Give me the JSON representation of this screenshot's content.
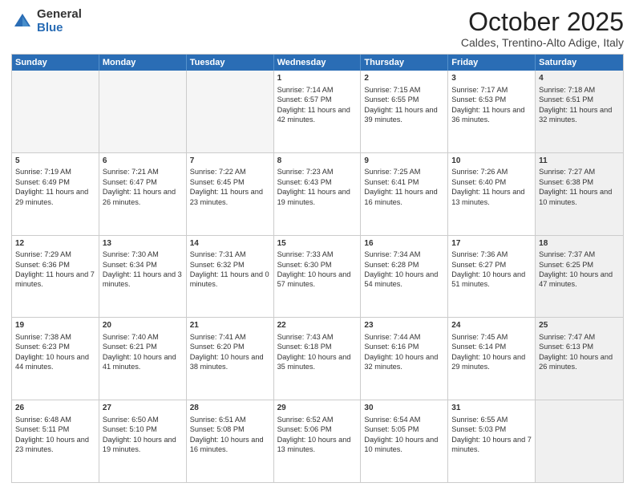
{
  "logo": {
    "general": "General",
    "blue": "Blue"
  },
  "title": {
    "month": "October 2025",
    "location": "Caldes, Trentino-Alto Adige, Italy"
  },
  "calendar": {
    "headers": [
      "Sunday",
      "Monday",
      "Tuesday",
      "Wednesday",
      "Thursday",
      "Friday",
      "Saturday"
    ],
    "rows": [
      [
        {
          "day": "",
          "info": "",
          "empty": true
        },
        {
          "day": "",
          "info": "",
          "empty": true
        },
        {
          "day": "",
          "info": "",
          "empty": true
        },
        {
          "day": "1",
          "info": "Sunrise: 7:14 AM\nSunset: 6:57 PM\nDaylight: 11 hours and 42 minutes."
        },
        {
          "day": "2",
          "info": "Sunrise: 7:15 AM\nSunset: 6:55 PM\nDaylight: 11 hours and 39 minutes."
        },
        {
          "day": "3",
          "info": "Sunrise: 7:17 AM\nSunset: 6:53 PM\nDaylight: 11 hours and 36 minutes."
        },
        {
          "day": "4",
          "info": "Sunrise: 7:18 AM\nSunset: 6:51 PM\nDaylight: 11 hours and 32 minutes.",
          "shaded": true
        }
      ],
      [
        {
          "day": "5",
          "info": "Sunrise: 7:19 AM\nSunset: 6:49 PM\nDaylight: 11 hours and 29 minutes."
        },
        {
          "day": "6",
          "info": "Sunrise: 7:21 AM\nSunset: 6:47 PM\nDaylight: 11 hours and 26 minutes."
        },
        {
          "day": "7",
          "info": "Sunrise: 7:22 AM\nSunset: 6:45 PM\nDaylight: 11 hours and 23 minutes."
        },
        {
          "day": "8",
          "info": "Sunrise: 7:23 AM\nSunset: 6:43 PM\nDaylight: 11 hours and 19 minutes."
        },
        {
          "day": "9",
          "info": "Sunrise: 7:25 AM\nSunset: 6:41 PM\nDaylight: 11 hours and 16 minutes."
        },
        {
          "day": "10",
          "info": "Sunrise: 7:26 AM\nSunset: 6:40 PM\nDaylight: 11 hours and 13 minutes."
        },
        {
          "day": "11",
          "info": "Sunrise: 7:27 AM\nSunset: 6:38 PM\nDaylight: 11 hours and 10 minutes.",
          "shaded": true
        }
      ],
      [
        {
          "day": "12",
          "info": "Sunrise: 7:29 AM\nSunset: 6:36 PM\nDaylight: 11 hours and 7 minutes."
        },
        {
          "day": "13",
          "info": "Sunrise: 7:30 AM\nSunset: 6:34 PM\nDaylight: 11 hours and 3 minutes."
        },
        {
          "day": "14",
          "info": "Sunrise: 7:31 AM\nSunset: 6:32 PM\nDaylight: 11 hours and 0 minutes."
        },
        {
          "day": "15",
          "info": "Sunrise: 7:33 AM\nSunset: 6:30 PM\nDaylight: 10 hours and 57 minutes."
        },
        {
          "day": "16",
          "info": "Sunrise: 7:34 AM\nSunset: 6:28 PM\nDaylight: 10 hours and 54 minutes."
        },
        {
          "day": "17",
          "info": "Sunrise: 7:36 AM\nSunset: 6:27 PM\nDaylight: 10 hours and 51 minutes."
        },
        {
          "day": "18",
          "info": "Sunrise: 7:37 AM\nSunset: 6:25 PM\nDaylight: 10 hours and 47 minutes.",
          "shaded": true
        }
      ],
      [
        {
          "day": "19",
          "info": "Sunrise: 7:38 AM\nSunset: 6:23 PM\nDaylight: 10 hours and 44 minutes."
        },
        {
          "day": "20",
          "info": "Sunrise: 7:40 AM\nSunset: 6:21 PM\nDaylight: 10 hours and 41 minutes."
        },
        {
          "day": "21",
          "info": "Sunrise: 7:41 AM\nSunset: 6:20 PM\nDaylight: 10 hours and 38 minutes."
        },
        {
          "day": "22",
          "info": "Sunrise: 7:43 AM\nSunset: 6:18 PM\nDaylight: 10 hours and 35 minutes."
        },
        {
          "day": "23",
          "info": "Sunrise: 7:44 AM\nSunset: 6:16 PM\nDaylight: 10 hours and 32 minutes."
        },
        {
          "day": "24",
          "info": "Sunrise: 7:45 AM\nSunset: 6:14 PM\nDaylight: 10 hours and 29 minutes."
        },
        {
          "day": "25",
          "info": "Sunrise: 7:47 AM\nSunset: 6:13 PM\nDaylight: 10 hours and 26 minutes.",
          "shaded": true
        }
      ],
      [
        {
          "day": "26",
          "info": "Sunrise: 6:48 AM\nSunset: 5:11 PM\nDaylight: 10 hours and 23 minutes."
        },
        {
          "day": "27",
          "info": "Sunrise: 6:50 AM\nSunset: 5:10 PM\nDaylight: 10 hours and 19 minutes."
        },
        {
          "day": "28",
          "info": "Sunrise: 6:51 AM\nSunset: 5:08 PM\nDaylight: 10 hours and 16 minutes."
        },
        {
          "day": "29",
          "info": "Sunrise: 6:52 AM\nSunset: 5:06 PM\nDaylight: 10 hours and 13 minutes."
        },
        {
          "day": "30",
          "info": "Sunrise: 6:54 AM\nSunset: 5:05 PM\nDaylight: 10 hours and 10 minutes."
        },
        {
          "day": "31",
          "info": "Sunrise: 6:55 AM\nSunset: 5:03 PM\nDaylight: 10 hours and 7 minutes."
        },
        {
          "day": "",
          "info": "",
          "empty": true,
          "shaded": true
        }
      ]
    ]
  }
}
